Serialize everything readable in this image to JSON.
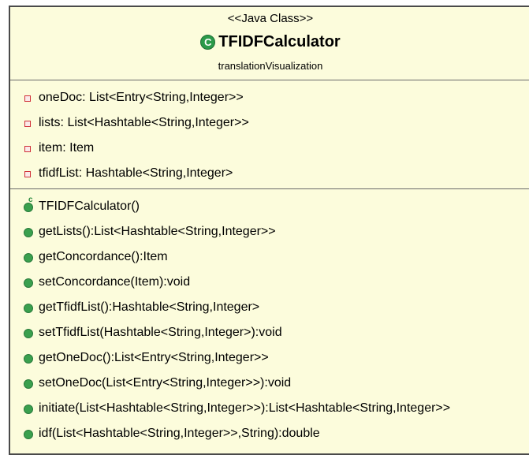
{
  "class_box": {
    "stereotype": "<<Java Class>>",
    "class_icon": "class-c-icon",
    "class_icon_letter": "C",
    "class_name": "TFIDFCalculator",
    "package": "translationVisualization",
    "colors": {
      "background": "#fcfcdc",
      "border": "#4a4a4a",
      "attribute_icon": "#d0303a",
      "method_icon": "#3aa04e"
    }
  },
  "attributes": [
    {
      "icon": "private-field-icon",
      "text": "oneDoc: List<Entry<String,Integer>>"
    },
    {
      "icon": "private-field-icon",
      "text": "lists: List<Hashtable<String,Integer>>"
    },
    {
      "icon": "private-field-icon",
      "text": "item: Item"
    },
    {
      "icon": "private-field-icon",
      "text": "tfidfList: Hashtable<String,Integer>"
    }
  ],
  "constructor": {
    "icon": "constructor-icon",
    "marker": "c",
    "text": "TFIDFCalculator()"
  },
  "operations": [
    {
      "icon": "public-method-icon",
      "text": "getLists():List<Hashtable<String,Integer>>"
    },
    {
      "icon": "public-method-icon",
      "text": "getConcordance():Item"
    },
    {
      "icon": "public-method-icon",
      "text": "setConcordance(Item):void"
    },
    {
      "icon": "public-method-icon",
      "text": "getTfidfList():Hashtable<String,Integer>"
    },
    {
      "icon": "public-method-icon",
      "text": "setTfidfList(Hashtable<String,Integer>):void"
    },
    {
      "icon": "public-method-icon",
      "text": "getOneDoc():List<Entry<String,Integer>>"
    },
    {
      "icon": "public-method-icon",
      "text": "setOneDoc(List<Entry<String,Integer>>):void"
    },
    {
      "icon": "public-method-icon",
      "text": "initiate(List<Hashtable<String,Integer>>):List<Hashtable<String,Integer>>"
    },
    {
      "icon": "public-method-icon",
      "text": "idf(List<Hashtable<String,Integer>>,String):double"
    }
  ]
}
